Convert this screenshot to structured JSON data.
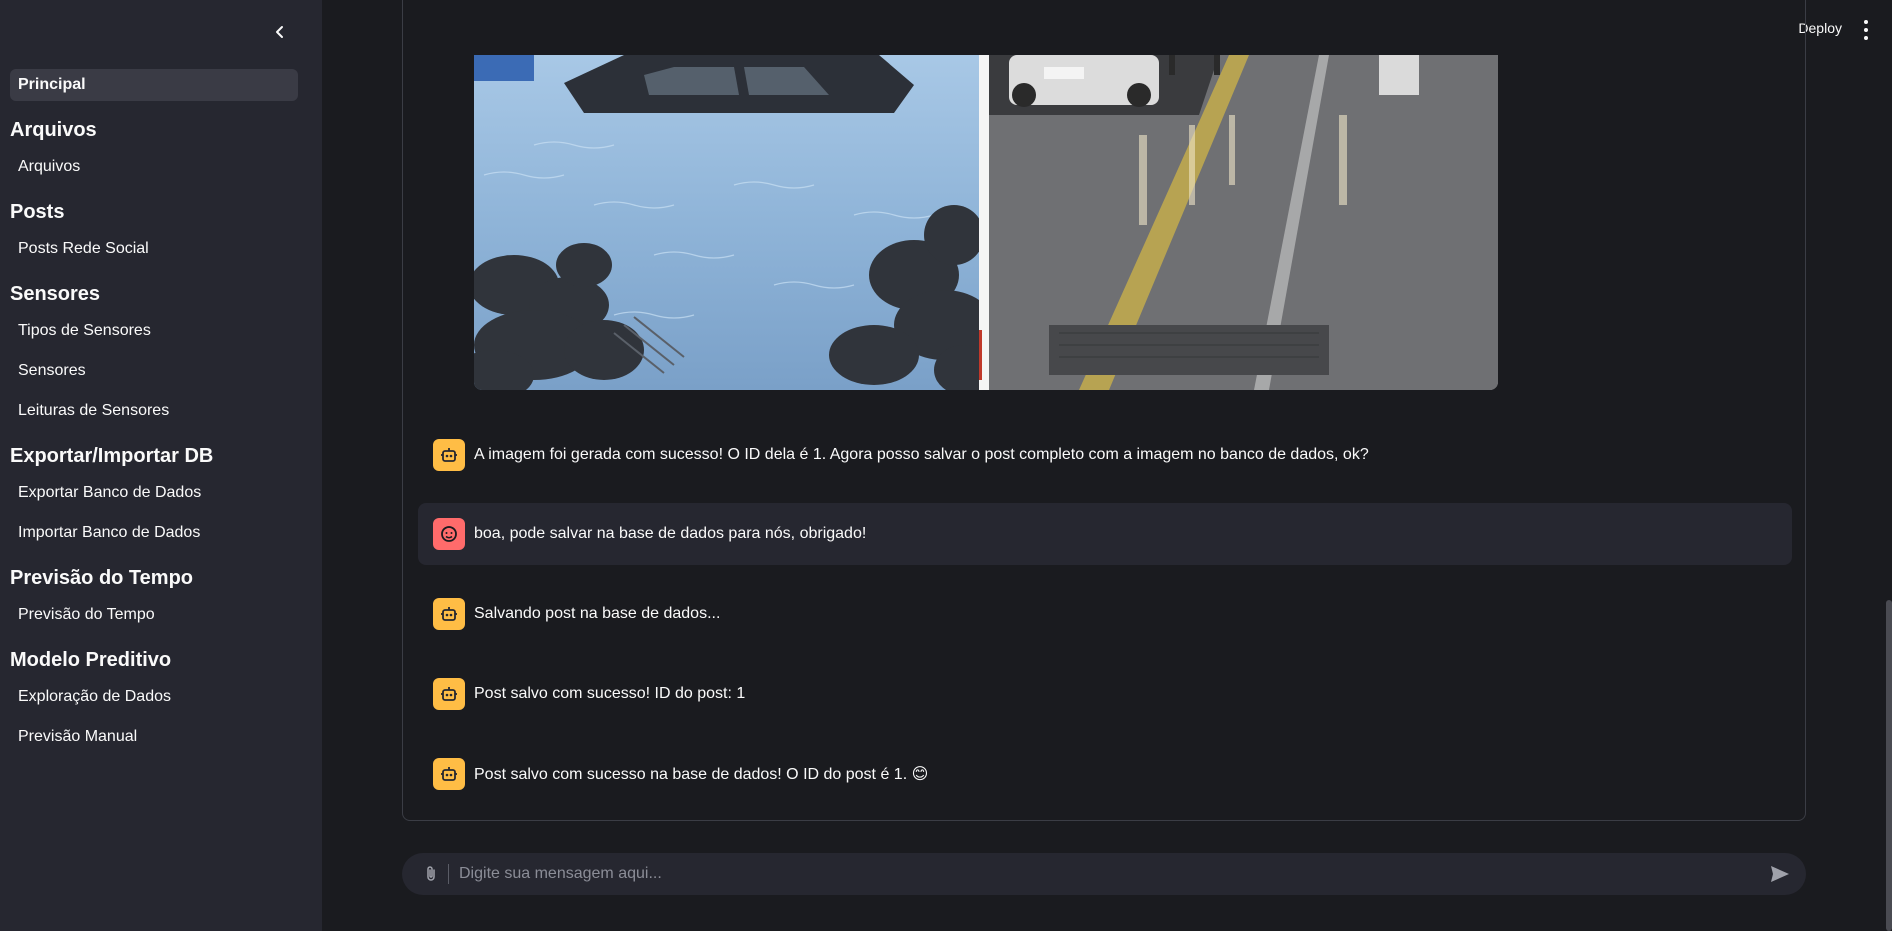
{
  "sidebar": {
    "items": [
      {
        "type": "item",
        "label": "Principal",
        "active": true,
        "name": "sidebar-item-principal"
      },
      {
        "type": "section",
        "label": "Arquivos",
        "name": "section-arquivos"
      },
      {
        "type": "item",
        "label": "Arquivos",
        "name": "sidebar-item-arquivos"
      },
      {
        "type": "section",
        "label": "Posts",
        "name": "section-posts"
      },
      {
        "type": "item",
        "label": "Posts Rede Social",
        "name": "sidebar-item-posts-rede-social"
      },
      {
        "type": "section",
        "label": "Sensores",
        "name": "section-sensores"
      },
      {
        "type": "item",
        "label": "Tipos de Sensores",
        "name": "sidebar-item-tipos-de-sensores"
      },
      {
        "type": "item",
        "label": "Sensores",
        "name": "sidebar-item-sensores"
      },
      {
        "type": "item",
        "label": "Leituras de Sensores",
        "name": "sidebar-item-leituras-de-sensores"
      },
      {
        "type": "section",
        "label": "Exportar/Importar DB",
        "name": "section-exportar-importar-db"
      },
      {
        "type": "item",
        "label": "Exportar Banco de Dados",
        "name": "sidebar-item-exportar-banco"
      },
      {
        "type": "item",
        "label": "Importar Banco de Dados",
        "name": "sidebar-item-importar-banco"
      },
      {
        "type": "section",
        "label": "Previsão do Tempo",
        "name": "section-previsao-do-tempo"
      },
      {
        "type": "item",
        "label": "Previsão do Tempo",
        "name": "sidebar-item-previsao-do-tempo"
      },
      {
        "type": "section",
        "label": "Modelo Preditivo",
        "name": "section-modelo-preditivo"
      },
      {
        "type": "item",
        "label": "Exploração de Dados",
        "name": "sidebar-item-exploracao-de-dados"
      },
      {
        "type": "item",
        "label": "Previsão Manual",
        "name": "sidebar-item-previsao-manual"
      }
    ]
  },
  "header": {
    "deploy_label": "Deploy"
  },
  "chat": {
    "messages": [
      {
        "role": "assistant",
        "text": "A imagem foi gerada com sucesso! O ID dela é 1. Agora posso salvar o post completo com a imagem no banco de dados, ok?"
      },
      {
        "role": "user",
        "text": "boa, pode salvar na base de dados para nós, obrigado!"
      },
      {
        "role": "assistant",
        "text": "Salvando post na base de dados..."
      },
      {
        "role": "assistant",
        "text": "Post salvo com sucesso! ID do post: 1"
      },
      {
        "role": "assistant",
        "text": "Post salvo com sucesso na base de dados! O ID do post é 1. 😊"
      }
    ],
    "input_placeholder": "Digite sua mensagem aqui..."
  }
}
